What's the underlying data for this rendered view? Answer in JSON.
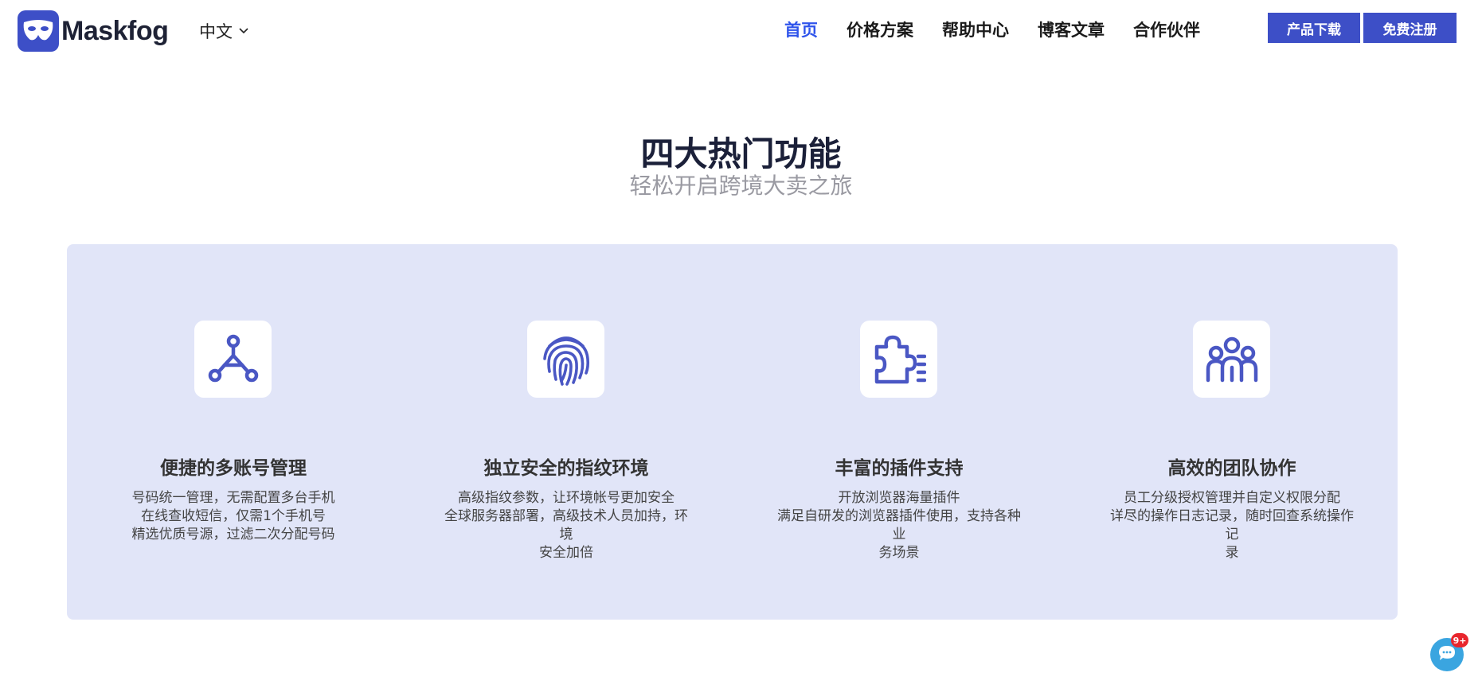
{
  "header": {
    "brand": "Maskfog",
    "language": "中文",
    "nav": [
      {
        "label": "首页",
        "active": true
      },
      {
        "label": "价格方案",
        "active": false
      },
      {
        "label": "帮助中心",
        "active": false
      },
      {
        "label": "博客文章",
        "active": false
      },
      {
        "label": "合作伙伴",
        "active": false
      }
    ],
    "download_label": "产品下载",
    "register_label": "免费注册"
  },
  "section": {
    "title": "四大热门功能",
    "subtitle": "轻松开启跨境大卖之旅"
  },
  "features": [
    {
      "icon": "network-nodes-icon",
      "title": "便捷的多账号管理",
      "lines": [
        "号码统一管理，无需配置多台手机",
        "在线查收短信，仅需1个手机号",
        "精选优质号源，过滤二次分配号码"
      ]
    },
    {
      "icon": "fingerprint-icon",
      "title": "独立安全的指纹环境",
      "lines": [
        "高级指纹参数，让环境帐号更加安全",
        "全球服务器部署，高级技术人员加持，环境",
        "安全加倍"
      ]
    },
    {
      "icon": "puzzle-plugin-icon",
      "title": "丰富的插件支持",
      "lines": [
        "开放浏览器海量插件",
        "满足自研发的浏览器插件使用，支持各种业",
        "务场景"
      ]
    },
    {
      "icon": "team-icon",
      "title": "高效的团队协作",
      "lines": [
        "员工分级授权管理并自定义权限分配",
        "详尽的操作日志记录，随时回查系统操作记",
        "录"
      ]
    }
  ],
  "chat": {
    "badge": "9+"
  },
  "colors": {
    "brand": "#3d4fc7",
    "active_nav": "#2f54eb",
    "panel_bg": "#e1e5f8",
    "icon": "#4a57c4"
  }
}
